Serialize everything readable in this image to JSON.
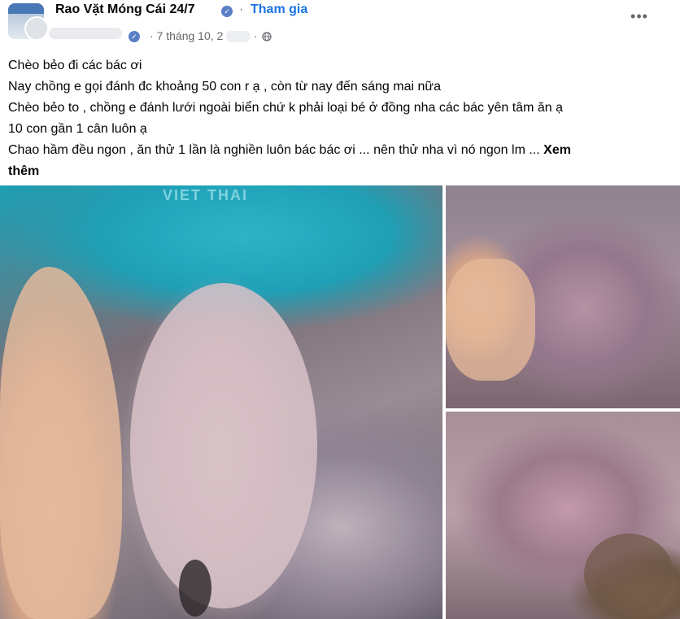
{
  "post": {
    "group_name": "Rao Vặt Móng Cái 24/7",
    "join_label": "Tham gia",
    "separator": "·",
    "timestamp": "7 tháng 10, 2",
    "more_label": "•••",
    "text_lines": [
      "Chèo bẻo đi các bác ơi",
      "Nay chồng e gọi đánh đc khoảng 50 con r ạ , còn từ nay đến sáng mai nữa",
      "Chèo bẻo to , chồng e đánh lưới ngoài biển chứ k phải loại bé ở đồng nha các bác yên tâm ăn ạ",
      "10 con gần 1 cân luôn ạ",
      "Chao hầm đều ngon , ăn thử 1 lần là nghiền luôn bác bác ơi ... nên thử nha vì nó ngon lm ..."
    ],
    "see_more_1": "Xem",
    "see_more_2": "thêm"
  },
  "photos": {
    "main_caption_text": "VIET THAI"
  },
  "icons": {
    "badge": "verified-group-badge-icon",
    "globe": "globe-icon",
    "more": "more-options-icon"
  },
  "colors": {
    "link_blue": "#1b74e4",
    "meta_gray": "#65676b",
    "text": "#050505",
    "badge_blue": "#5b7fc7"
  }
}
